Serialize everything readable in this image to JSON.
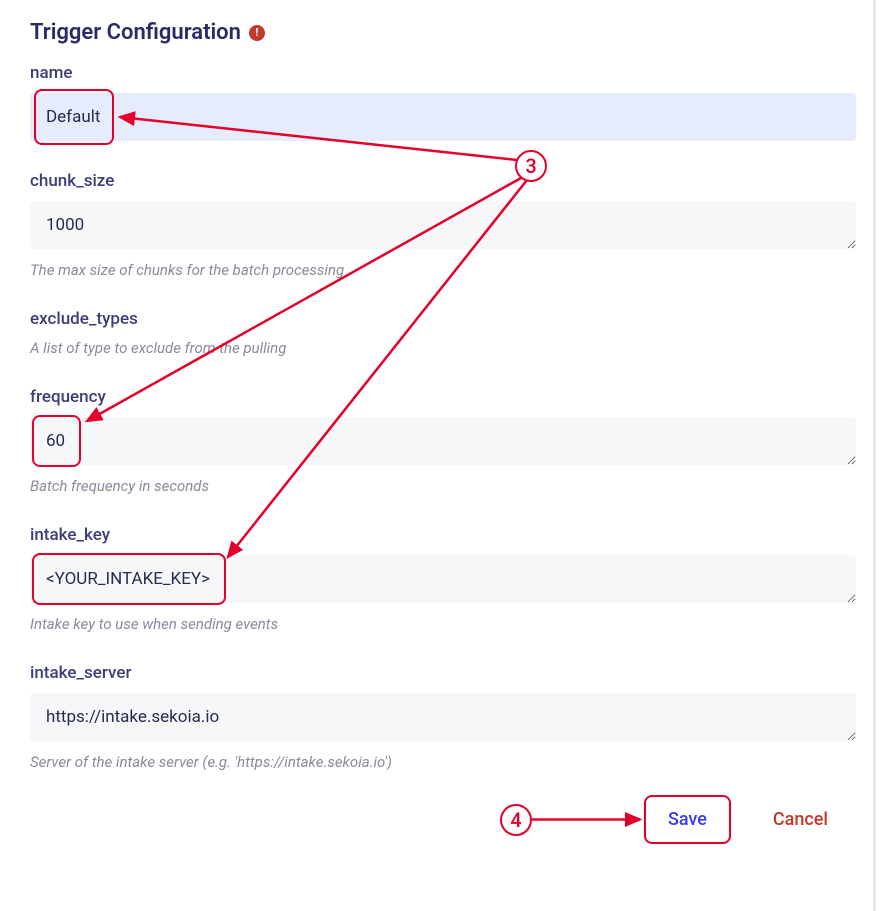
{
  "section": {
    "title": "Trigger Configuration"
  },
  "fields": {
    "name": {
      "label": "name",
      "value": "Default"
    },
    "chunk_size": {
      "label": "chunk_size",
      "value": "1000",
      "help": "The max size of chunks for the batch processing"
    },
    "exclude_types": {
      "label": "exclude_types",
      "help": "A list of type to exclude from the pulling"
    },
    "frequency": {
      "label": "frequency",
      "value": "60",
      "help": "Batch frequency in seconds"
    },
    "intake_key": {
      "label": "intake_key",
      "value": "<YOUR_INTAKE_KEY>",
      "help": "Intake key to use when sending events"
    },
    "intake_server": {
      "label": "intake_server",
      "value": "https://intake.sekoia.io",
      "help": "Server of the intake server (e.g. 'https://intake.sekoia.io')"
    }
  },
  "buttons": {
    "save": "Save",
    "cancel": "Cancel"
  },
  "annotations": {
    "step3": "3",
    "step4": "4"
  }
}
